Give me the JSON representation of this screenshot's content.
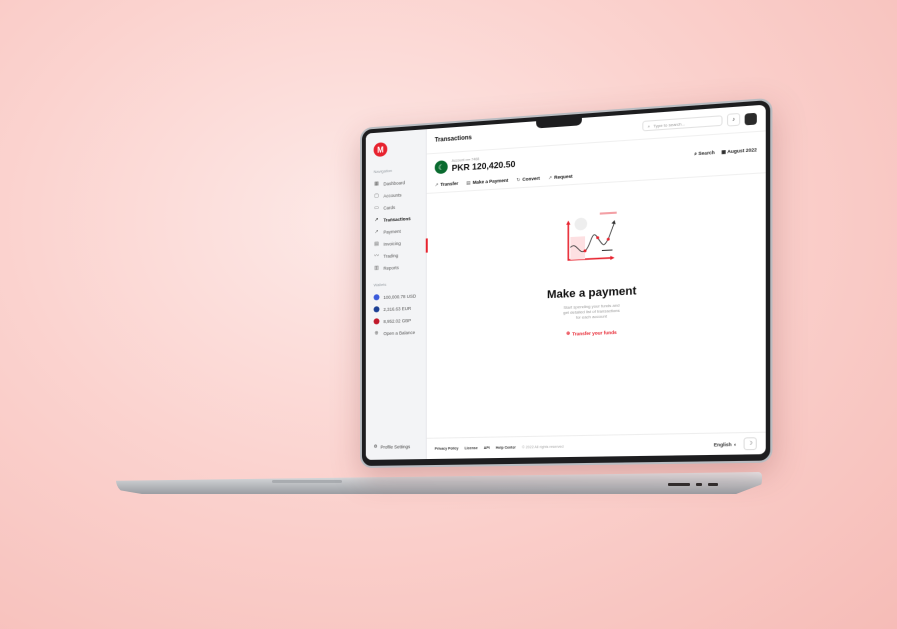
{
  "topbar": {
    "title": "Transactions",
    "search_placeholder": "Type to search..."
  },
  "account": {
    "label": "Account •••• 7468",
    "balance": "PKR 120,420.50"
  },
  "tools": {
    "search": "Search",
    "month": "August 2022"
  },
  "actions": [
    "Transfer",
    "Make a Payment",
    "Convert",
    "Request"
  ],
  "sidebar": {
    "nav_label": "Navigation",
    "items": [
      "Dashboard",
      "Accounts",
      "Cards",
      "Transactions",
      "Payment",
      "Invoicing",
      "Trading",
      "Reports"
    ],
    "active": "Transactions",
    "wallets_label": "Wallets",
    "wallets": [
      {
        "label": "100,000.78 USD",
        "color": "#3b5bdb"
      },
      {
        "label": "2,316.63 EUR",
        "color": "#1c3f94"
      },
      {
        "label": "8,952.02 GBP",
        "color": "#c0182a"
      }
    ],
    "open_balance": "Open a Balance",
    "profile": "Profile Settings"
  },
  "empty": {
    "title": "Make a payment",
    "description": "Start spending your funds and get detailed list of transactions for each account",
    "cta": "Transfer your funds"
  },
  "footer": {
    "links": [
      "Privacy Policy",
      "License",
      "API",
      "Help Center"
    ],
    "copyright": "© 2022 All rights reserved",
    "language": "English"
  },
  "colors": {
    "accent": "#e7222e"
  }
}
